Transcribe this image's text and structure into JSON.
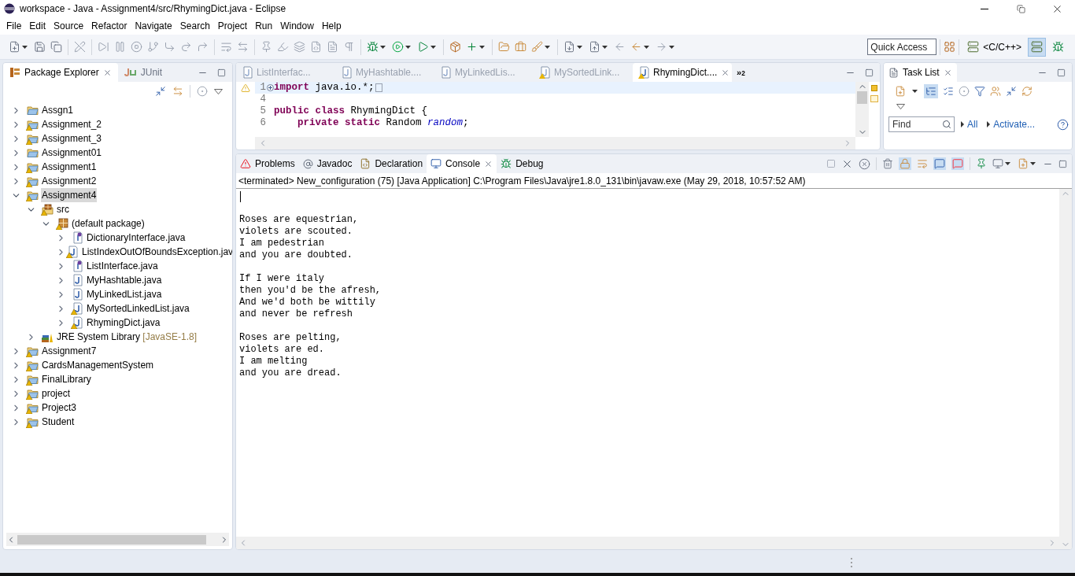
{
  "window": {
    "title": "workspace - Java - Assignment4/src/RhymingDict.java - Eclipse"
  },
  "menu": [
    "File",
    "Edit",
    "Source",
    "Refactor",
    "Navigate",
    "Search",
    "Project",
    "Run",
    "Window",
    "Help"
  ],
  "quick_access": {
    "placeholder": "Quick Access"
  },
  "perspectives": [
    {
      "kind": "cpp",
      "label": "<C/C++>",
      "selected": false
    },
    {
      "kind": "java",
      "selected": true
    },
    {
      "kind": "debug",
      "selected": false
    }
  ],
  "explorer": {
    "tabs": [
      {
        "label": "Package Explorer",
        "kind": "explorer",
        "selected": true
      },
      {
        "label": "JUnit",
        "kind": "junit",
        "selected": false
      }
    ],
    "tree": [
      {
        "label": "Assgn1",
        "kind": "project",
        "warning": false,
        "expanded": false,
        "selected": false
      },
      {
        "label": "Assignment_2",
        "kind": "project",
        "warning": true,
        "expanded": false,
        "selected": false
      },
      {
        "label": "Assignment_3",
        "kind": "project",
        "warning": true,
        "expanded": false,
        "selected": false
      },
      {
        "label": "Assignment01",
        "kind": "project",
        "warning": false,
        "expanded": false,
        "selected": false
      },
      {
        "label": "Assignment1",
        "kind": "project",
        "warning": true,
        "expanded": false,
        "selected": false
      },
      {
        "label": "Assignment2",
        "kind": "project",
        "warning": true,
        "expanded": false,
        "selected": false
      },
      {
        "label": "Assignment4",
        "kind": "project",
        "warning": true,
        "expanded": true,
        "selected": true,
        "children": [
          {
            "label": "src",
            "kind": "source_folder",
            "warning": true,
            "expanded": true,
            "selected": false,
            "children": [
              {
                "label": "(default package)",
                "kind": "package",
                "warning": true,
                "expanded": true,
                "selected": false,
                "children": [
                  {
                    "label": "DictionaryInterface.java",
                    "kind": "interface",
                    "warning": false,
                    "expanded": false,
                    "selected": false
                  },
                  {
                    "label": "ListIndexOutOfBoundsException.jav",
                    "kind": "class",
                    "warning": true,
                    "expanded": false,
                    "selected": false
                  },
                  {
                    "label": "ListInterface.java",
                    "kind": "interface",
                    "warning": false,
                    "expanded": false,
                    "selected": false
                  },
                  {
                    "label": "MyHashtable.java",
                    "kind": "class",
                    "warning": false,
                    "expanded": false,
                    "selected": false
                  },
                  {
                    "label": "MyLinkedList.java",
                    "kind": "class",
                    "warning": false,
                    "expanded": false,
                    "selected": false
                  },
                  {
                    "label": "MySortedLinkedList.java",
                    "kind": "class",
                    "warning": true,
                    "expanded": false,
                    "selected": false
                  },
                  {
                    "label": "RhymingDict.java",
                    "kind": "class",
                    "warning": true,
                    "expanded": false,
                    "selected": false
                  }
                ]
              }
            ]
          },
          {
            "label": "JRE System Library",
            "decoration": "[JavaSE-1.8]",
            "kind": "library",
            "warning": false,
            "expanded": false,
            "selected": false
          }
        ]
      },
      {
        "label": "Assignment7",
        "kind": "project",
        "warning": true,
        "expanded": false,
        "selected": false
      },
      {
        "label": "CardsManagementSystem",
        "kind": "project",
        "warning": true,
        "expanded": false,
        "selected": false
      },
      {
        "label": "FinalLibrary",
        "kind": "project",
        "warning": true,
        "expanded": false,
        "selected": false
      },
      {
        "label": "project",
        "kind": "project",
        "warning": true,
        "expanded": false,
        "selected": false
      },
      {
        "label": "Project3",
        "kind": "project",
        "warning": true,
        "expanded": false,
        "selected": false
      },
      {
        "label": "Student",
        "kind": "project",
        "warning": true,
        "expanded": false,
        "selected": false
      }
    ]
  },
  "editor": {
    "tabs": [
      {
        "label": "ListInterfac...",
        "warning": false,
        "selected": false
      },
      {
        "label": "MyHashtable....",
        "warning": false,
        "selected": false
      },
      {
        "label": "MyLinkedLis...",
        "warning": false,
        "selected": false
      },
      {
        "label": "MySortedLink...",
        "warning": true,
        "selected": false
      },
      {
        "label": "RhymingDict....",
        "warning": true,
        "selected": true
      }
    ],
    "overflow": "»$_{2}$",
    "lines": [
      {
        "number": "1",
        "folded": true,
        "current": true,
        "tokens": [
          {
            "text": "import",
            "kind": "keyword"
          },
          {
            "text": " java.io.*;",
            "kind": "plain"
          }
        ]
      },
      {
        "number": "4",
        "folded": false,
        "current": false
      },
      {
        "number": "5",
        "folded": false,
        "current": false,
        "tokens": [
          {
            "text": "public class",
            "kind": "keyword"
          },
          {
            "text": " RhymingDict {",
            "kind": "plain"
          }
        ]
      },
      {
        "number": "6",
        "folded": false,
        "current": false,
        "tokens": [
          {
            "text": "    private static",
            "kind": "keyword"
          },
          {
            "text": " Random ",
            "kind": "plain"
          },
          {
            "text": "random",
            "kind": "field"
          },
          {
            "text": ";",
            "kind": "plain"
          }
        ]
      }
    ]
  },
  "task_list": {
    "title": "Task List",
    "find": {
      "placeholder": "Find"
    },
    "links": [
      "All",
      "Activate..."
    ]
  },
  "bottom": {
    "tabs": [
      {
        "label": "Problems",
        "kind": "problems",
        "selected": false
      },
      {
        "label": "Javadoc",
        "kind": "javadoc",
        "selected": false
      },
      {
        "label": "Declaration",
        "kind": "declaration",
        "selected": false
      },
      {
        "label": "Console",
        "kind": "console",
        "selected": true
      },
      {
        "label": "Debug",
        "kind": "debug",
        "selected": false
      }
    ],
    "console": {
      "header": "<terminated> New_configuration (75) [Java Application] C:\\Program Files\\Java\\jre1.8.0_131\\bin\\javaw.exe (May 29, 2018, 10:57:52 AM)",
      "stanzas": [
        [
          "Roses are equestrian,",
          "violets are scouted.",
          "I am pedestrian",
          "and you are doubted."
        ],
        [
          "If I were italy",
          "then you'd be the afresh,",
          "And we'd both be wittily",
          "and never be refresh"
        ],
        [
          "Roses are pelting,",
          "violets are ed.",
          "I am melting",
          "and you are dread."
        ]
      ]
    }
  }
}
